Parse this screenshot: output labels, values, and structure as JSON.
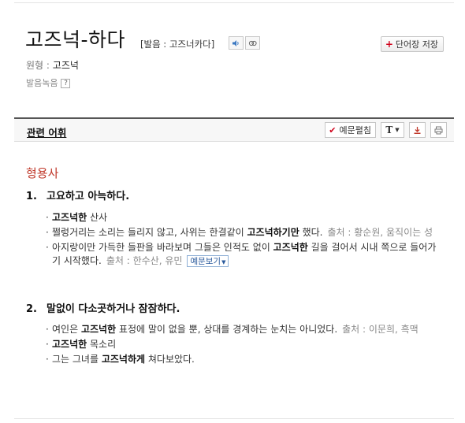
{
  "entry": {
    "headword": "고즈넉-하다",
    "pronunciation": "[발음 : 고즈너카다]",
    "save_label": "단어장 저장",
    "origin_label": "원형",
    "origin_value": "고즈넉",
    "recording_label": "발음녹음",
    "help_mark": "?"
  },
  "toolbar": {
    "related_label": "관련 어휘",
    "examples_label": "예문펼침",
    "font_label": "T"
  },
  "pos": "형용사",
  "senses": [
    {
      "num": "1.",
      "definition": "고요하고 아늑하다.",
      "examples": [
        {
          "pre": "",
          "bold": "고즈넉한",
          "post": " 산사",
          "source": ""
        },
        {
          "pre": "쩔렁거리는 소리는 들리지 않고, 사위는 한결같이 ",
          "bold": "고즈넉하기만",
          "post": " 했다.",
          "source": "출처 : 황순원, 움직이는 성"
        },
        {
          "pre": "아지랑이만 가득한 들판을 바라보며 그들은 인적도 없이 ",
          "bold": "고즈넉한",
          "post": " 길을 걸어서 시내 쪽으로 들어가기 시작했다.",
          "source": "출처 : 한수산, 유민"
        }
      ],
      "more_label": "예문보기"
    },
    {
      "num": "2.",
      "definition": "말없이 다소곳하거나 잠잠하다.",
      "examples": [
        {
          "pre": "여인은 ",
          "bold": "고즈넉한",
          "post": " 표정에 말이 없을 뿐, 상대를 경계하는 눈치는 아니었다.",
          "source": "출처 : 이문희, 흑맥"
        },
        {
          "pre": "",
          "bold": "고즈넉한",
          "post": " 목소리",
          "source": ""
        },
        {
          "pre": "그는 그녀를 ",
          "bold": "고즈넉하게",
          "post": " 쳐다보았다.",
          "source": ""
        }
      ]
    }
  ],
  "colors": {
    "pos": "#c0392b",
    "accent": "#d0021b",
    "link": "#2a5a9c"
  },
  "icons": [
    "speaker-icon",
    "slow-audio-icon",
    "plus-icon",
    "check-icon",
    "chevron-down-icon",
    "download-icon",
    "print-icon"
  ]
}
